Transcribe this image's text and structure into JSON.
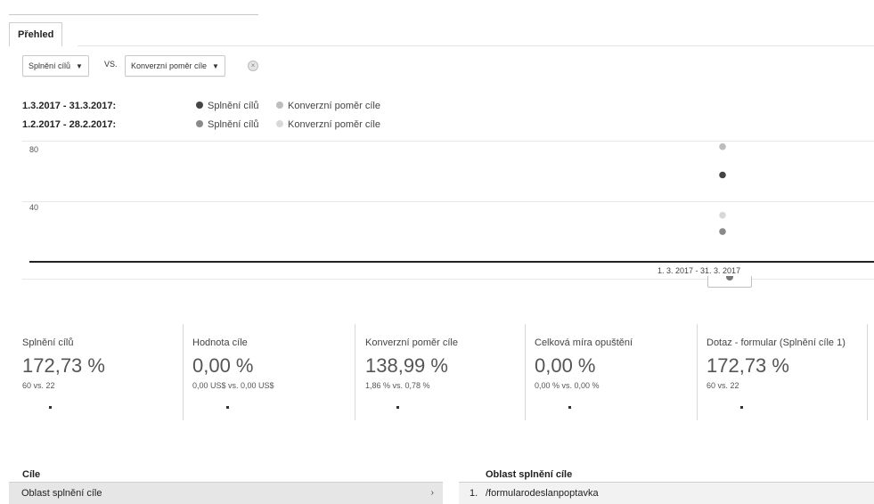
{
  "tabs": {
    "overview": "Přehled"
  },
  "controls": {
    "metric1": "Splnění cílů",
    "vs": "VS.",
    "metric2": "Konverzní poměr cíle"
  },
  "dateranges": [
    {
      "range": "1.3.2017 - 31.3.2017:",
      "legend1": "Splnění cílů",
      "legend2": "Konverzní poměr cíle",
      "color1": "#444444",
      "color2": "#bdbdbd"
    },
    {
      "range": "1.2.2017 - 28.2.2017:",
      "legend1": "Splnění cílů",
      "legend2": "Konverzní poměr cíle",
      "color1": "#8a8a8a",
      "color2": "#d8d8d8"
    }
  ],
  "chart_data": {
    "type": "scatter",
    "y_ticks": [
      "80",
      "40"
    ],
    "ylim": [
      0,
      100
    ],
    "x_label": "1. 3. 2017 - 31. 3. 2017",
    "series": [
      {
        "name": "Splnění cílů",
        "period": "1.3.2017 - 31.3.2017",
        "values": [
          60
        ],
        "color": "#444444"
      },
      {
        "name": "Konverzní poměr cíle",
        "period": "1.3.2017 - 31.3.2017",
        "values": [
          79
        ],
        "color": "#bdbdbd"
      },
      {
        "name": "Splnění cílů",
        "period": "1.2.2017 - 28.2.2017",
        "values": [
          22
        ],
        "color": "#8a8a8a"
      },
      {
        "name": "Konverzní poměr cíle",
        "period": "1.2.2017 - 28.2.2017",
        "values": [
          33
        ],
        "color": "#d8d8d8"
      }
    ]
  },
  "metrics": [
    {
      "label": "Splnění cílů",
      "value": "172,73 %",
      "compare": "60 vs. 22"
    },
    {
      "label": "Hodnota cíle",
      "value": "0,00 %",
      "compare": "0,00 US$ vs. 0,00 US$"
    },
    {
      "label": "Konverzní poměr cíle",
      "value": "138,99 %",
      "compare": "1,86 % vs. 0,78 %"
    },
    {
      "label": "Celková míra opuštění",
      "value": "0,00 %",
      "compare": "0,00 % vs. 0,00 %"
    },
    {
      "label": "Dotaz - formular (Splnění cíle 1)",
      "value": "172,73 %",
      "compare": "60 vs. 22"
    }
  ],
  "goals": {
    "title": "Cíle",
    "row1": "Oblast splnění cíle"
  },
  "goal_area": {
    "title": "Oblast splnění cíle",
    "row1_index": "1.",
    "row1_value": "/formularodeslanpoptavka"
  }
}
